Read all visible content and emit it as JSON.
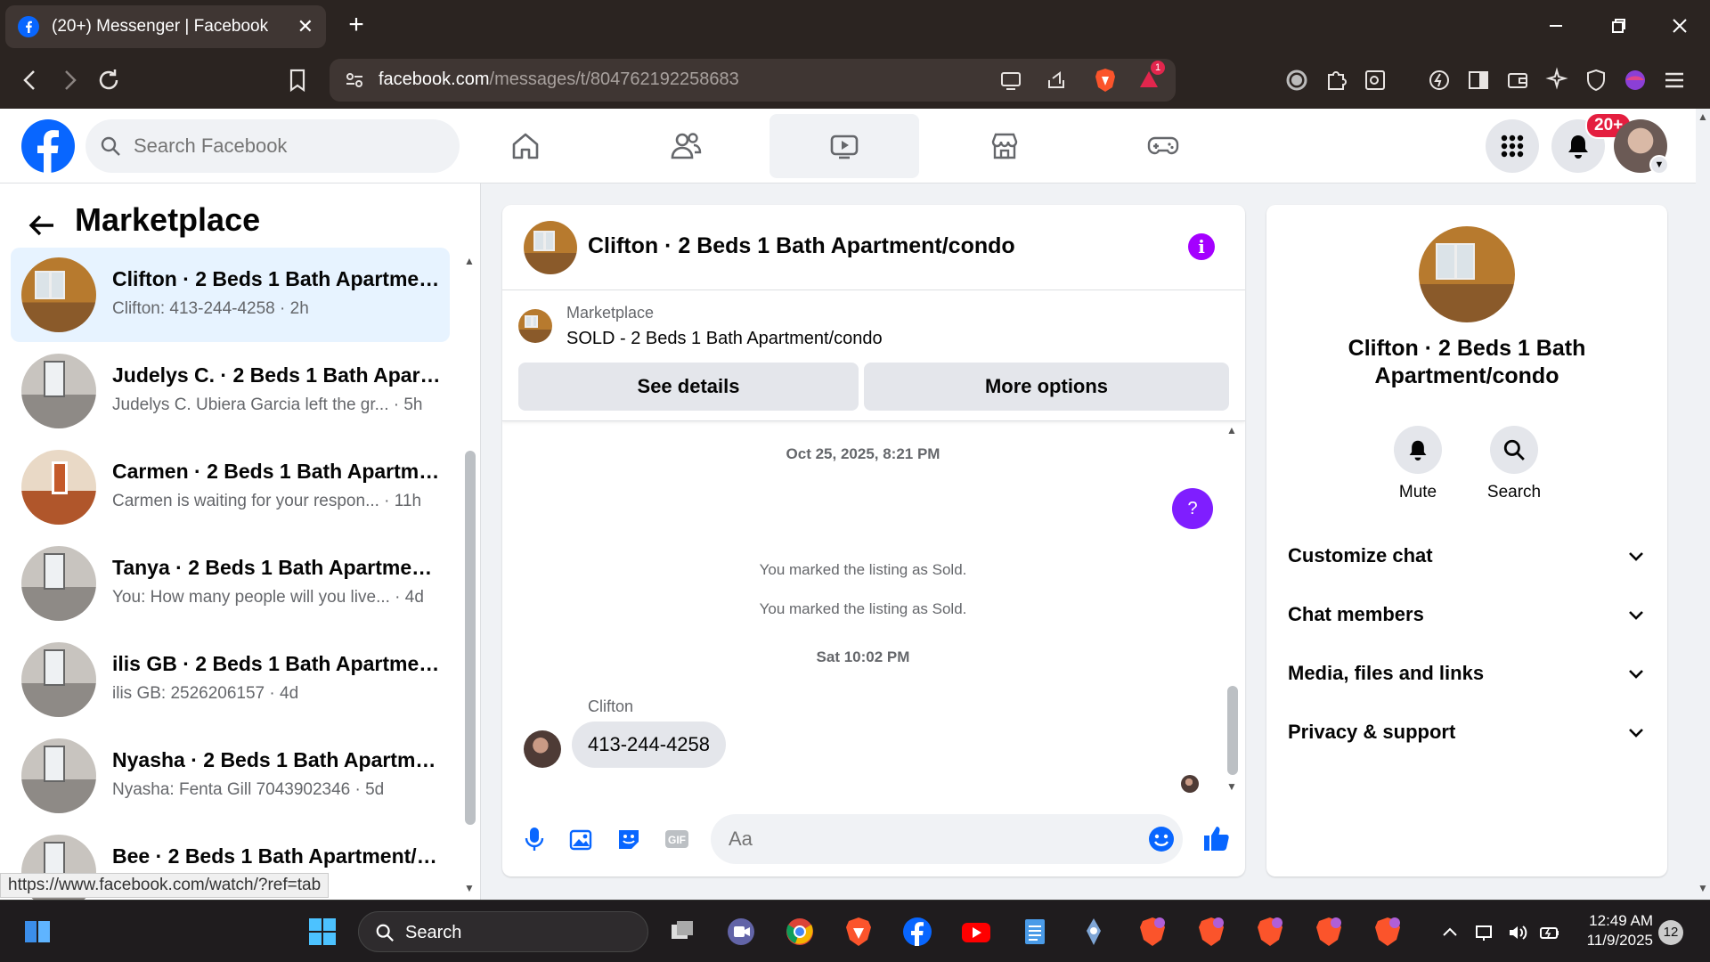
{
  "browser": {
    "tab_title": "(20+) Messenger | Facebook",
    "url_prefix": "facebook.com",
    "url_path": "/messages/t/804762192258683",
    "ext_badge": "1"
  },
  "fb": {
    "search_placeholder": "Search Facebook",
    "notif_count": "20+"
  },
  "left": {
    "title": "Marketplace",
    "conversations": [
      {
        "title": "Clifton · 2 Beds 1 Bath Apartmen...",
        "sub": "Clifton: 413-244-4258 · 2h"
      },
      {
        "title": "Judelys C. · 2 Beds 1 Bath Apart...",
        "sub": "Judelys C. Ubiera Garcia left the gr... · 5h"
      },
      {
        "title": "Carmen · 2 Beds 1 Bath Apartme...",
        "sub": "Carmen is waiting for your respon... · 11h"
      },
      {
        "title": "Tanya · 2 Beds 1 Bath Apartment...",
        "sub": "You: How many people will you live... · 4d"
      },
      {
        "title": "ilis GB · 2 Beds 1 Bath Apartmen...",
        "sub": "ilis GB: 2526206157 · 4d"
      },
      {
        "title": "Nyasha · 2 Beds 1 Bath Apartme...",
        "sub": "Nyasha: Fenta Gill 7043902346 · 5d"
      },
      {
        "title": "Bee · 2 Beds 1 Bath Apartment/c...",
        "sub": ""
      }
    ]
  },
  "status_url": "https://www.facebook.com/watch/?ref=tab",
  "chat": {
    "title": "Clifton · 2 Beds 1 Bath Apartment/condo",
    "listing_label": "Marketplace",
    "listing_title": "SOLD - 2 Beds 1 Bath Apartment/condo",
    "see_details": "See details",
    "more_options": "More options",
    "timestamp1": "Oct 25, 2025, 8:21 PM",
    "question_mark": "?",
    "sys1": "You marked the listing as Sold.",
    "sys2": "You marked the listing as Sold.",
    "timestamp2": "Sat 10:02 PM",
    "sender": "Clifton",
    "message": "413-244-4258",
    "input_placeholder": "Aa"
  },
  "right": {
    "title": "Clifton · 2 Beds 1 Bath Apartment/condo",
    "mute": "Mute",
    "search": "Search",
    "rows": [
      "Customize chat",
      "Chat members",
      "Media, files and links",
      "Privacy & support"
    ]
  },
  "taskbar": {
    "search": "Search",
    "time": "12:49 AM",
    "date": "11/9/2025",
    "badge": "12"
  },
  "colors": {
    "fb_blue": "#0866ff",
    "messenger_purple": "#a400ff",
    "selected_row": "#e7f3ff"
  }
}
